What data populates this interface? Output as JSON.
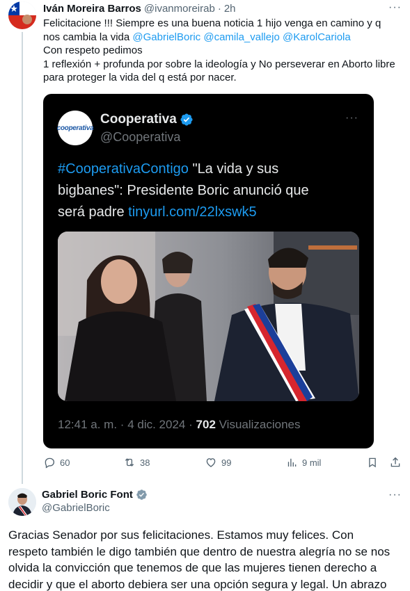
{
  "tweet1": {
    "author_name": "Iván Moreira Barros",
    "author_handle": "@ivanmoreirab",
    "separator": "·",
    "time": "2h",
    "more": "···",
    "text_lines": [
      "Felicitacione !!! Siempre es una buena noticia 1 hijo venga en camino y q",
      "nos cambia la vida ",
      "Con respeto pedimos",
      "1 reflexión + profunda por sobre la ideología y No perseverar en Aborto libre",
      "para proteger la vida del q está por nacer."
    ],
    "mentions": [
      "@GabrielBoric",
      "@camila_vallejo",
      "@KarolCariola"
    ],
    "actions": {
      "reply_count": "60",
      "retweet_count": "38",
      "like_count": "99",
      "views_count": "9 mil"
    }
  },
  "quote": {
    "author_name": "Cooperativa",
    "author_handle": "@Cooperativa",
    "avatar_text": "cooperativa",
    "more": "···",
    "hashtag": "#CooperativaContigo",
    "text_line1_rest": " \"La vida y sus",
    "text_line2": "bigbanes\": Presidente Boric anunció que",
    "text_line3": "será padre ",
    "link": "tinyurl.com/22lxswk5",
    "time": "12:41 a. m.",
    "separator": "·",
    "date": "4 dic. 2024",
    "views_count": "702",
    "views_label": "Visualizaciones"
  },
  "tweet2": {
    "author_name": "Gabriel Boric Font",
    "author_handle": "@GabrielBoric",
    "more": "···",
    "text_lines": [
      "Gracias Senador por sus felicitaciones. Estamos muy felices. Con",
      "respeto también le digo también que dentro de nuestra alegría no se nos",
      "olvida la convicción que tenemos de que las mujeres tienen derecho a",
      "decidir y que el aborto debiera ser una opción segura y legal. Un abrazo"
    ]
  },
  "colors": {
    "accent": "#1d9bf0",
    "secondary_text": "#536471",
    "card_background": "#000000",
    "verified_gray": "#829aab"
  }
}
